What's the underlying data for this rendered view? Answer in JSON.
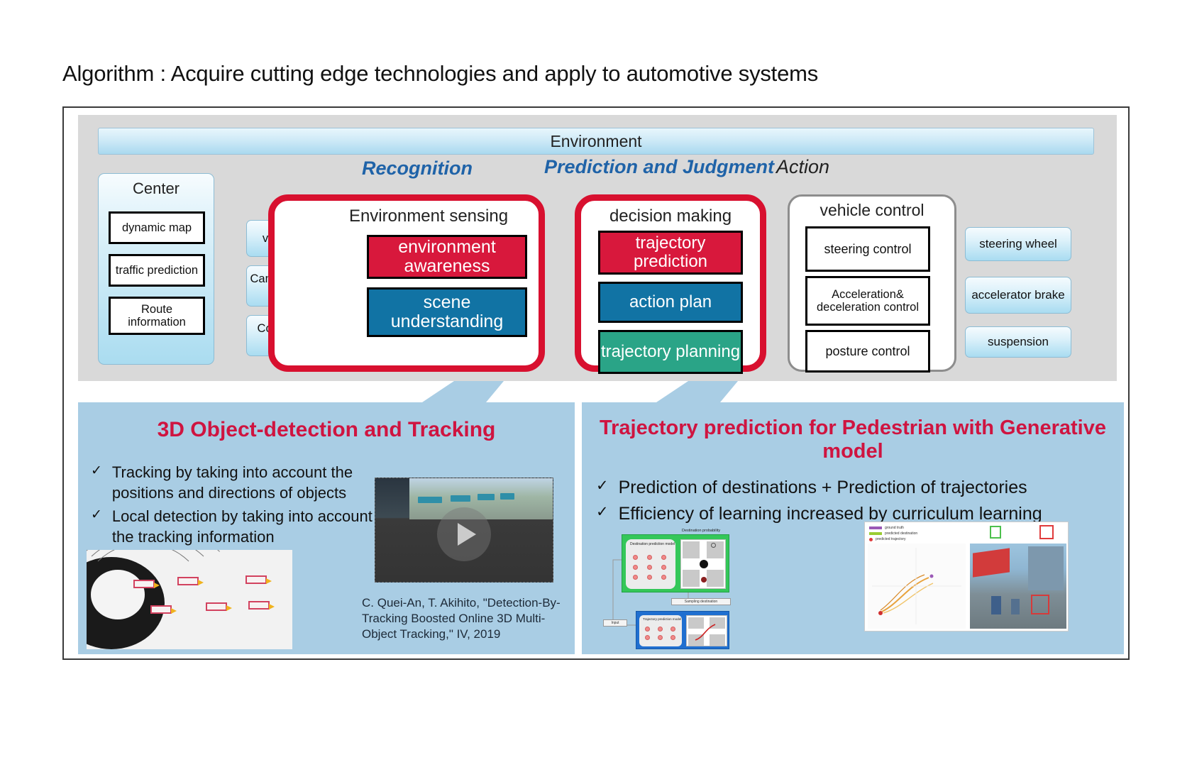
{
  "slide": {
    "title": "Algorithm : Acquire cutting edge technologies and apply to automotive systems"
  },
  "architecture": {
    "environment_bar": "Environment",
    "phases": [
      {
        "id": "recognition",
        "label": "Recognition"
      },
      {
        "id": "prediction",
        "label": "Prediction and Judgment"
      },
      {
        "id": "action",
        "label": "Action"
      }
    ],
    "center": {
      "title": "Center",
      "items": [
        "dynamic map",
        "traffic prediction",
        "Route information"
      ]
    },
    "sensors": [
      "vehicle Sensor",
      "Camera / millimeter wave",
      "Communications Device"
    ],
    "environment_sensing": {
      "title": "Environment  sensing",
      "blocks": [
        {
          "label": "environment awareness",
          "color": "#d8183c"
        },
        {
          "label": "scene understanding",
          "color": "#1173a4"
        }
      ]
    },
    "decision_making": {
      "title": "decision making",
      "blocks": [
        {
          "label": "trajectory prediction",
          "color": "#d8183c"
        },
        {
          "label": "action plan",
          "color": "#1173a4"
        },
        {
          "label": "trajectory planning",
          "color": "#2aa487"
        }
      ]
    },
    "vehicle_control": {
      "title": "vehicle control",
      "items": [
        "steering control",
        "Acceleration& deceleration control",
        "posture control"
      ]
    },
    "actuators": [
      "steering wheel",
      "accelerator brake",
      "suspension"
    ]
  },
  "callouts": [
    {
      "id": "object-detection",
      "title": "3D Object-detection and Tracking",
      "bullets": [
        "Tracking by taking into account the positions and directions of objects",
        "Local detection by taking into account the tracking information"
      ],
      "citation": "C. Quei-An, T. Akihito, \"Detection-By-Tracking Boosted Online 3D Multi-Object Tracking,\" IV, 2019",
      "video_caption": "",
      "figure_labels": []
    },
    {
      "id": "trajectory-prediction",
      "title": "Trajectory prediction for Pedestrian with Generative model",
      "bullets": [
        "Prediction of destinations + Prediction of trajectories",
        "Efficiency of learning increased by curriculum learning"
      ],
      "figure_labels": {
        "input": "Input",
        "destination_model": "Destination prediction model",
        "destination_probability": "Destination probability",
        "sampling_destination": "Sampling destination",
        "trajectory_model": "Trajectory prediction model"
      },
      "legend": [
        "ground truth",
        "predicted destination",
        "predicted trajectory"
      ]
    }
  ],
  "colors": {
    "accent_red": "#d8102f",
    "title_red": "#cf1440",
    "phase_blue": "#1f63a8",
    "callout_blue": "#a9cde4",
    "band_grey": "#d9d9d9",
    "green": "#2aa487"
  },
  "icons": {
    "play": "play-icon",
    "check": "✓"
  }
}
